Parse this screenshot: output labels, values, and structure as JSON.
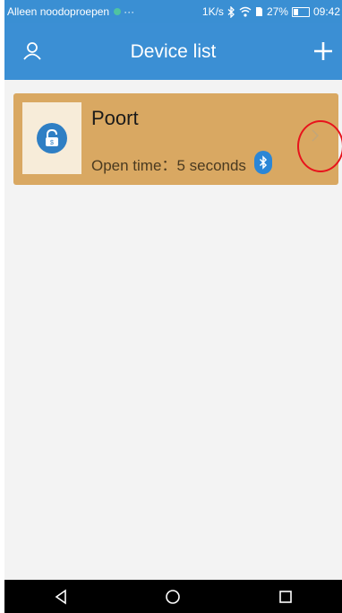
{
  "status_bar": {
    "carrier_text": "Alleen noodoproepen",
    "overflow_text": "···",
    "network_speed": "1K/s",
    "battery_percent": "27%",
    "time": "09:42",
    "icons": [
      "notification-dot-icon",
      "bluetooth-icon",
      "wifi-icon",
      "sim-icon",
      "battery-icon"
    ]
  },
  "app_bar": {
    "title": "Device list",
    "left_icon": "user-icon",
    "right_icon": "add-icon",
    "color": "#3b8fd4"
  },
  "devices": [
    {
      "name": "Poort",
      "open_time_label": "Open time：",
      "open_time_value": "5 seconds",
      "icons": [
        "lock-icon",
        "bluetooth-icon",
        "chevron-right-icon"
      ],
      "card_color": "#d9a862"
    }
  ],
  "annotation": {
    "shape": "circle",
    "color": "#e8131c",
    "target": "chevron-right-icon"
  },
  "nav_bar": {
    "buttons": [
      "back-icon",
      "home-icon",
      "recents-icon"
    ]
  }
}
